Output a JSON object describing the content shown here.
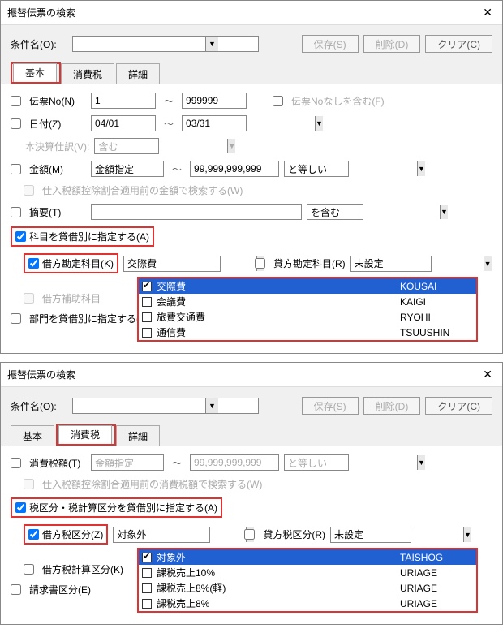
{
  "d1": {
    "title": "振替伝票の検索",
    "cond_label": "条件名(O):",
    "save": "保存(S)",
    "delete": "削除(D)",
    "clear": "クリア(C)",
    "tabs": {
      "basic": "基本",
      "tax": "消費税",
      "detail": "詳細"
    },
    "slip_no": "伝票No(N)",
    "slip_from": "1",
    "slip_to": "999999",
    "slip_none": "伝票Noなしを含む(F)",
    "date": "日付(Z)",
    "date_from": "04/01",
    "date_to": "03/31",
    "hon": "本決算仕訳(V):",
    "hon_val": "含む",
    "amount": "金額(M)",
    "amount_kind": "金額指定",
    "amount_to": "99,999,999,999",
    "amount_op": "と等しい",
    "pretax": "仕入税額控除割合適用前の金額で検索する(W)",
    "memo": "摘要(T)",
    "memo_op": "を含む",
    "by_drcr": "科目を貸借別に指定する(A)",
    "dr_acct": "借方勘定科目(K)",
    "dr_acct_val": "交際費",
    "cr_acct": "貸方勘定科目(R)",
    "cr_acct_val": "未設定",
    "dr_sub": "借方補助科目",
    "dept": "部門を貸借別に指定する(",
    "list": [
      {
        "chk": true,
        "name": "交際費",
        "code": "KOUSAI",
        "sel": true
      },
      {
        "chk": false,
        "name": "会議費",
        "code": "KAIGI"
      },
      {
        "chk": false,
        "name": "旅費交通費",
        "code": "RYOHI"
      },
      {
        "chk": false,
        "name": "通信費",
        "code": "TSUUSHIN"
      }
    ]
  },
  "d2": {
    "title": "振替伝票の検索",
    "cond_label": "条件名(O):",
    "save": "保存(S)",
    "delete": "削除(D)",
    "clear": "クリア(C)",
    "tabs": {
      "basic": "基本",
      "tax": "消費税",
      "detail": "詳細"
    },
    "tax_amt": "消費税額(T)",
    "amount_kind": "金額指定",
    "amount_to": "99,999,999,999",
    "amount_op": "と等しい",
    "pretax": "仕入税額控除割合適用前の消費税額で検索する(W)",
    "by_drcr": "税区分・税計算区分を貸借別に指定する(A)",
    "dr_tax": "借方税区分(Z)",
    "dr_tax_val": "対象外",
    "cr_tax": "貸方税区分(R)",
    "cr_tax_val": "未設定",
    "dr_calc": "借方税計算区分(K)",
    "inv": "請求書区分(E)",
    "list": [
      {
        "chk": true,
        "name": "対象外",
        "code": "TAISHOG",
        "sel": true
      },
      {
        "chk": false,
        "name": "課税売上10%",
        "code": "URIAGE"
      },
      {
        "chk": false,
        "name": "課税売上8%(軽)",
        "code": "URIAGE"
      },
      {
        "chk": false,
        "name": "課税売上8%",
        "code": "URIAGE"
      }
    ]
  },
  "tilde": "～"
}
